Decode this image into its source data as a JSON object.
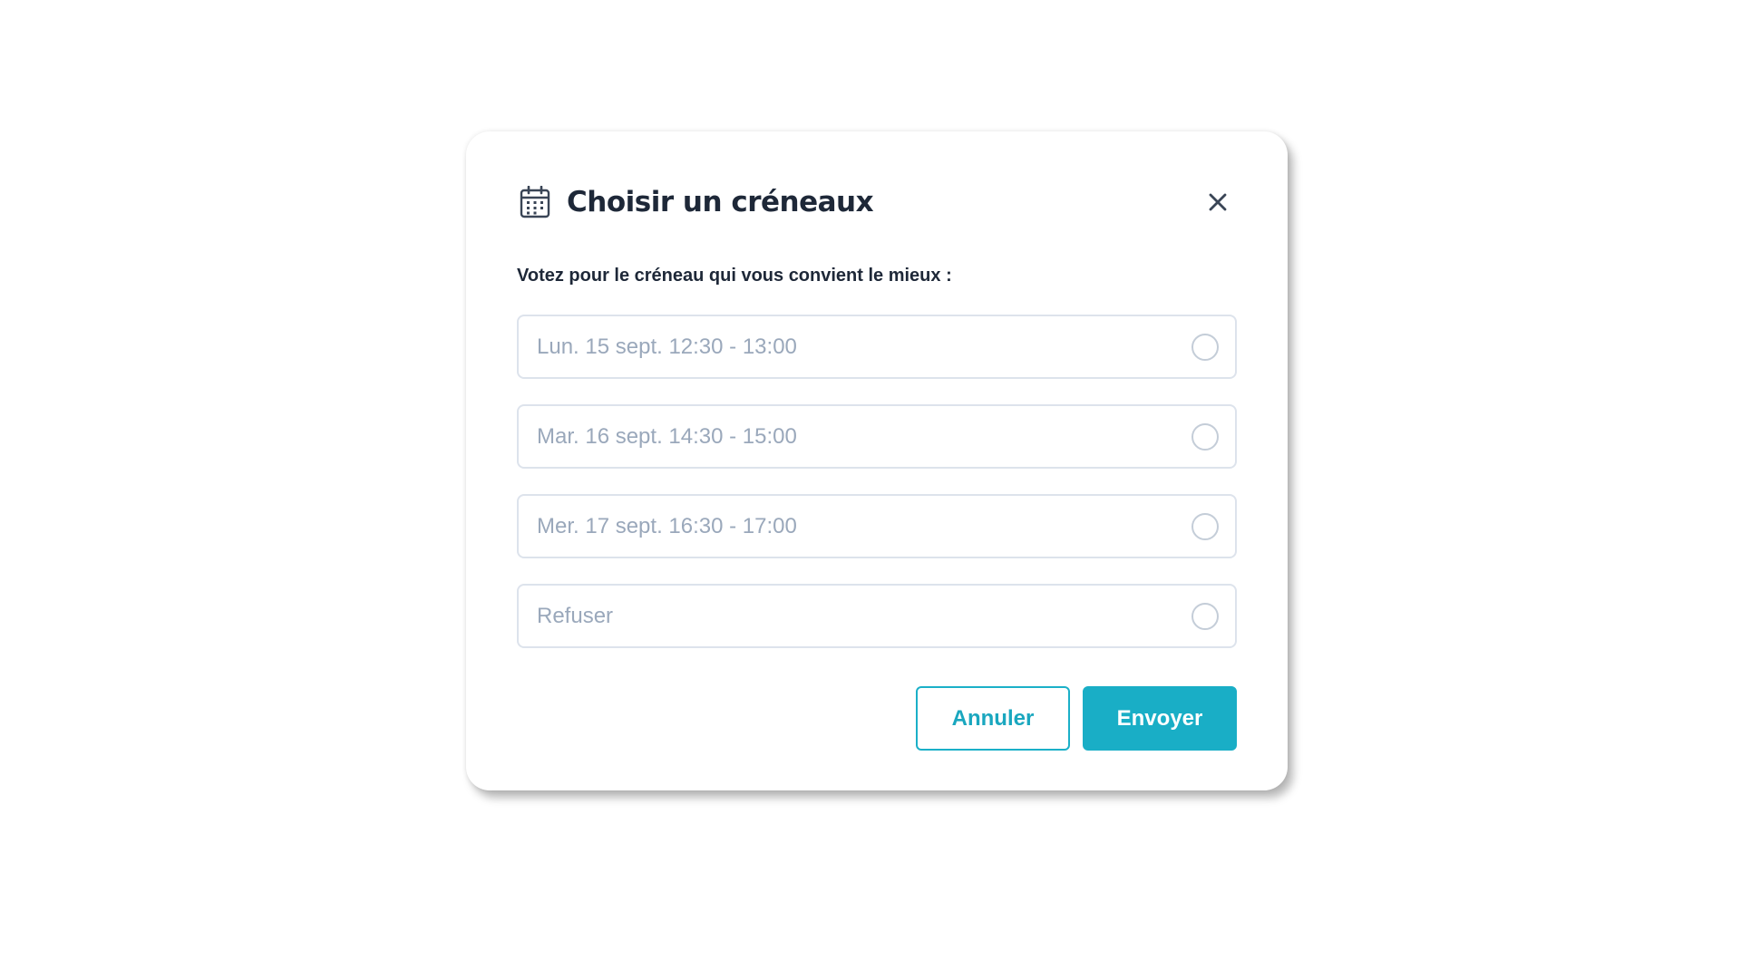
{
  "dialog": {
    "title": "Choisir un créneaux",
    "icon": "calendar-icon",
    "close_icon": "close-icon",
    "instruction": "Votez pour le créneau qui vous convient le mieux :",
    "options": [
      {
        "label": "Lun. 15 sept. 12:30 - 13:00",
        "selected": false
      },
      {
        "label": "Mar. 16 sept. 14:30 - 15:00",
        "selected": false
      },
      {
        "label": "Mer. 17 sept. 16:30 - 17:00",
        "selected": false
      },
      {
        "label": "Refuser",
        "selected": false
      }
    ],
    "cancel_label": "Annuler",
    "submit_label": "Envoyer"
  },
  "colors": {
    "accent": "#19aec6",
    "title_text": "#1e2838",
    "option_text": "#9aa8bb",
    "option_border": "#dde3ec"
  }
}
